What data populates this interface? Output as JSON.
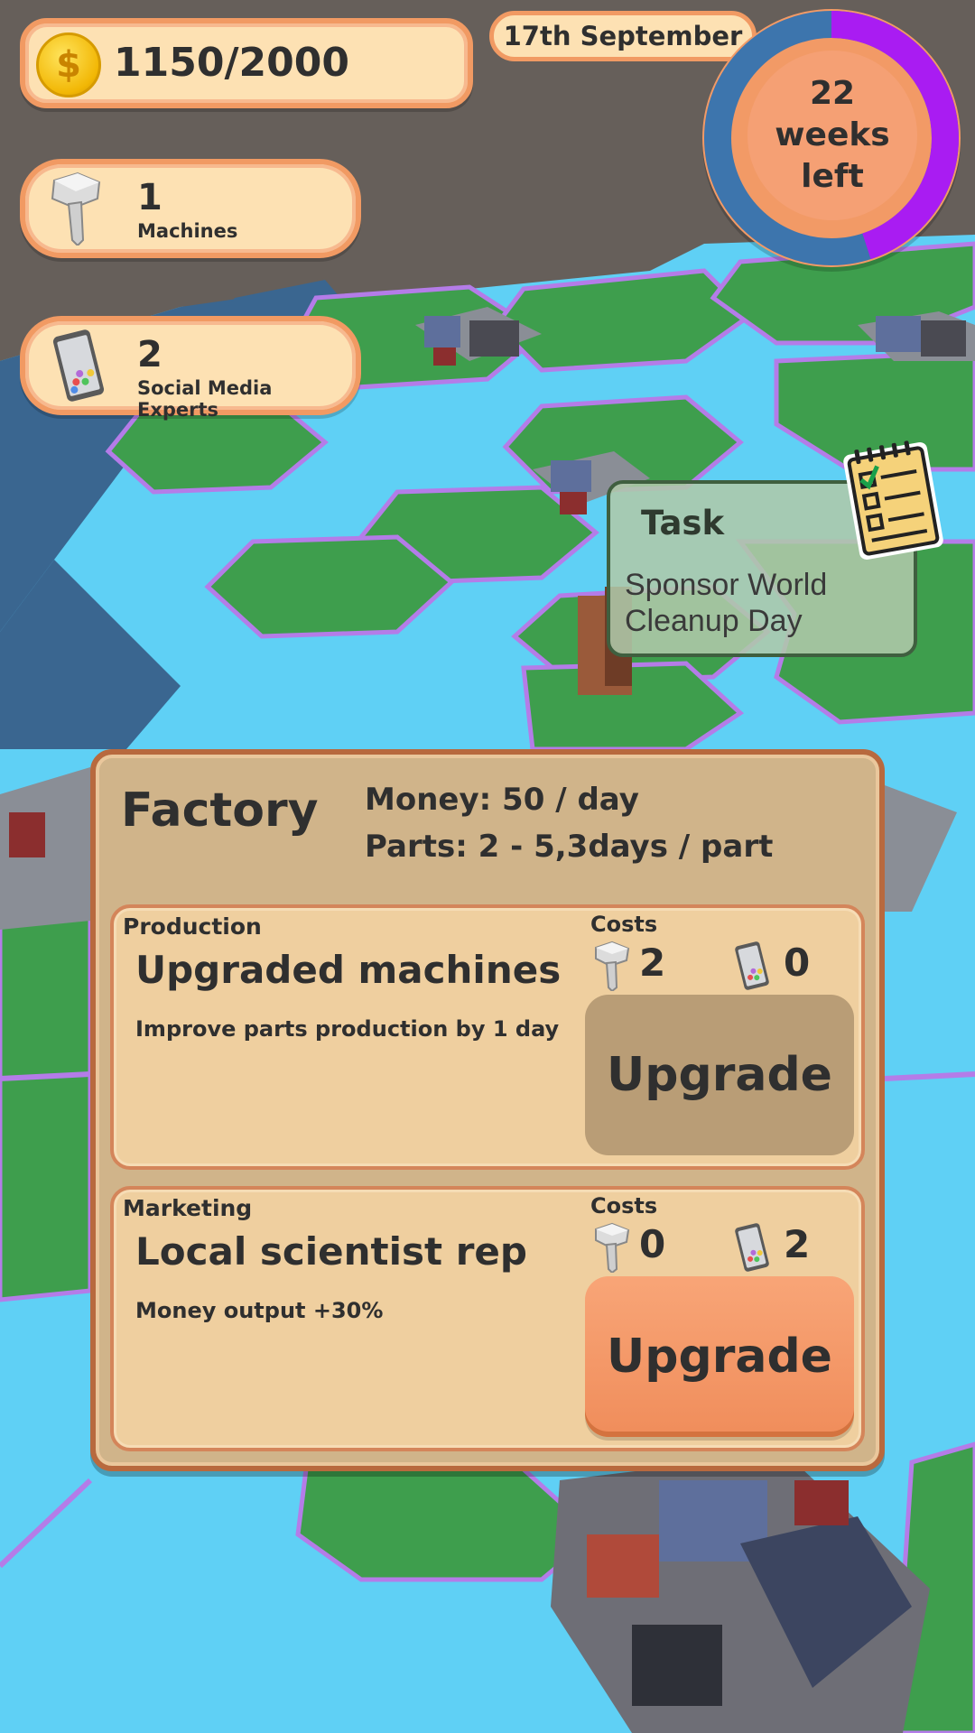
{
  "hud": {
    "money": "1150/2000",
    "money_icon": "gold-coin-icon",
    "date": "17th September",
    "weeks_left": {
      "line1": "22 weeks",
      "line2": "left",
      "progress_fraction": 0.45,
      "progress_color": "#a91cf2"
    },
    "machines": {
      "count": "1",
      "label": "Machines",
      "icon": "nail-icon"
    },
    "experts": {
      "count": "2",
      "label": "Social Media Experts",
      "icon": "phone-icon"
    }
  },
  "task": {
    "title": "Task",
    "text": "Sponsor World Cleanup Day",
    "icon": "notepad-checklist-icon"
  },
  "factory": {
    "title": "Factory",
    "money_rate": "Money: 50 / day",
    "parts_rate": "Parts: 2 - 5,3days / part",
    "production": {
      "category": "Production",
      "name": "Upgraded machines",
      "description": "Improve parts production by 1 day",
      "costs_label": "Costs",
      "machine_cost": "2",
      "expert_cost": "0",
      "button_label": "Upgrade",
      "button_state": "disabled"
    },
    "marketing": {
      "category": "Marketing",
      "name": "Local scientist rep",
      "description": "Money output +30%",
      "costs_label": "Costs",
      "machine_cost": "0",
      "expert_cost": "2",
      "button_label": "Upgrade",
      "button_state": "active"
    }
  },
  "colors": {
    "accent_orange": "#f19a63",
    "panel_cream": "#fde1b3",
    "water": "#5fd0f5",
    "grass": "#3e9e4d",
    "ocean": "#3a6690",
    "border_purple": "#b47ce8",
    "timer_purple": "#a91cf2"
  }
}
